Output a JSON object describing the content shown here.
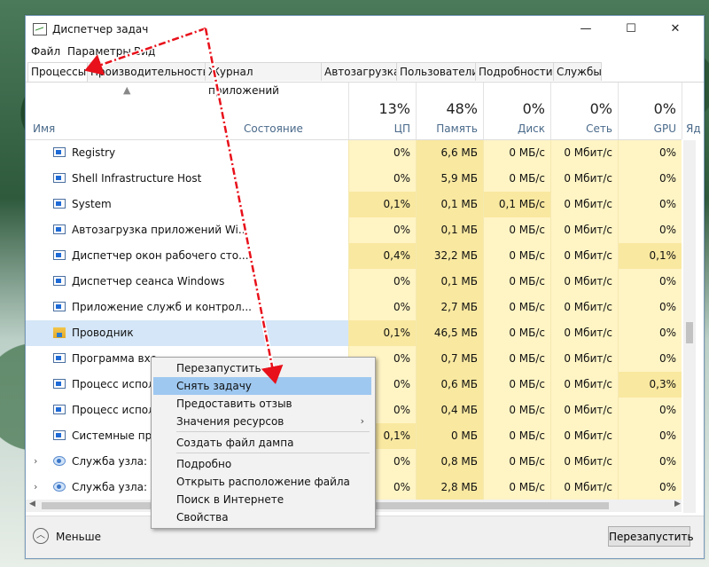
{
  "title": "Диспетчер задач",
  "window_buttons": {
    "minimize": "—",
    "maximize": "☐",
    "close": "✕"
  },
  "menu": [
    "Файл",
    "Параметры",
    "Вид"
  ],
  "tabs": [
    "Процессы",
    "Производительность",
    "Журнал приложений",
    "Автозагрузка",
    "Пользователи",
    "Подробности",
    "Службы"
  ],
  "active_tab": "Процессы",
  "columns": {
    "name": "Имя",
    "state": "Состояние",
    "cpu": {
      "pct": "13%",
      "label": "ЦП"
    },
    "mem": {
      "pct": "48%",
      "label": "Память"
    },
    "disk": {
      "pct": "0%",
      "label": "Диск"
    },
    "net": {
      "pct": "0%",
      "label": "Сеть"
    },
    "gpu": {
      "pct": "0%",
      "label": "GPU"
    },
    "extra": {
      "label": "Яд"
    }
  },
  "processes": [
    {
      "name": "Registry",
      "cpu": "0%",
      "mem": "6,6 МБ",
      "disk": "0 МБ/с",
      "net": "0 Мбит/с",
      "gpu": "0%"
    },
    {
      "name": "Shell Infrastructure Host",
      "cpu": "0%",
      "mem": "5,9 МБ",
      "disk": "0 МБ/с",
      "net": "0 Мбит/с",
      "gpu": "0%"
    },
    {
      "name": "System",
      "cpu": "0,1%",
      "mem": "0,1 МБ",
      "disk": "0,1 МБ/с",
      "net": "0 Мбит/с",
      "gpu": "0%"
    },
    {
      "name": "Автозагрузка приложений Wi...",
      "cpu": "0%",
      "mem": "0,1 МБ",
      "disk": "0 МБ/с",
      "net": "0 Мбит/с",
      "gpu": "0%"
    },
    {
      "name": "Диспетчер окон рабочего сто...",
      "cpu": "0,4%",
      "mem": "32,2 МБ",
      "disk": "0 МБ/с",
      "net": "0 Мбит/с",
      "gpu": "0,1%"
    },
    {
      "name": "Диспетчер сеанса Windows",
      "cpu": "0%",
      "mem": "0,1 МБ",
      "disk": "0 МБ/с",
      "net": "0 Мбит/с",
      "gpu": "0%"
    },
    {
      "name": "Приложение служб и контрол...",
      "cpu": "0%",
      "mem": "2,7 МБ",
      "disk": "0 МБ/с",
      "net": "0 Мбит/с",
      "gpu": "0%"
    },
    {
      "name": "Проводник",
      "cpu": "0,1%",
      "mem": "46,5 МБ",
      "disk": "0 МБ/с",
      "net": "0 Мбит/с",
      "gpu": "0%"
    },
    {
      "name": "Программа вхо",
      "cpu": "0%",
      "mem": "0,7 МБ",
      "disk": "0 МБ/с",
      "net": "0 Мбит/с",
      "gpu": "0%"
    },
    {
      "name": "Процесс испол",
      "cpu": "0%",
      "mem": "0,6 МБ",
      "disk": "0 МБ/с",
      "net": "0 Мбит/с",
      "gpu": "0,3%"
    },
    {
      "name": "Процесс испол",
      "cpu": "0%",
      "mem": "0,4 МБ",
      "disk": "0 МБ/с",
      "net": "0 Мбит/с",
      "gpu": "0%"
    },
    {
      "name": "Системные пре",
      "cpu": "0,1%",
      "mem": "0 МБ",
      "disk": "0 МБ/с",
      "net": "0 Мбит/с",
      "gpu": "0%"
    },
    {
      "name": "Служба узла: D",
      "cpu": "0%",
      "mem": "0,8 МБ",
      "disk": "0 МБ/с",
      "net": "0 Мбит/с",
      "gpu": "0%"
    },
    {
      "name": "Служба узла: D",
      "cpu": "0%",
      "mem": "2,8 МБ",
      "disk": "0 МБ/с",
      "net": "0 Мбит/с",
      "gpu": "0%"
    }
  ],
  "context_menu": [
    "Перезапустить",
    "Снять задачу",
    "Предоставить отзыв",
    "Значения ресурсов",
    "Создать файл дампа",
    "Подробно",
    "Открыть расположение файла",
    "Поиск в Интернете",
    "Свойства"
  ],
  "footer": {
    "less_label": "Меньше",
    "restart_button": "Перезапустить"
  },
  "colors": {
    "accent_selection": "#d4e6f7",
    "heat_cell": "#fff4c4",
    "annotation_arrow": "#e8101a",
    "menu_highlight": "#9ec8f0"
  }
}
